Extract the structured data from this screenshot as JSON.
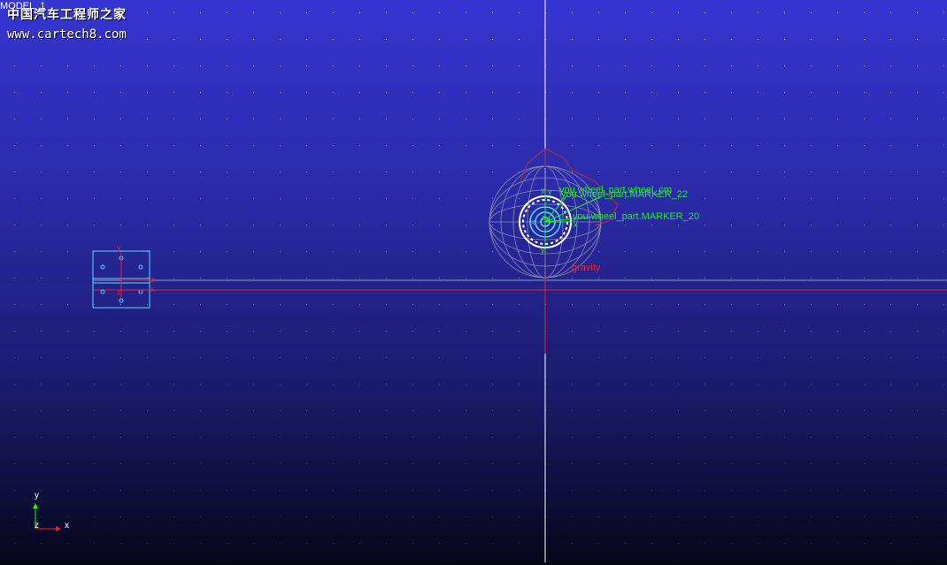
{
  "view": {
    "model_name": "MODEL_1",
    "watermark_cn": "中国汽车工程师之家",
    "watermark_url": "www.cartech8.com"
  },
  "colors": {
    "bg_top": "#3535d2",
    "bg_bottom": "#06061a",
    "grid_dot": "#c8c8ff",
    "marker_green": "#22ee22",
    "gravity_red": "#ee2222",
    "part_cyan": "#5ad7ff",
    "wheel_mesh": "#8a8aa8",
    "ground_axis_white": "#ffffff"
  },
  "markers": {
    "overlap_a": "you.wheel_part.wheel_cm",
    "overlap_b": "you.wheel_part.MARKER_22",
    "marker_20": "you.wheel_part.MARKER_20"
  },
  "gravity": {
    "label": "gravity"
  },
  "axis_letters": {
    "x": "x",
    "y": "y",
    "z": "z"
  },
  "triad": {
    "x": "x",
    "y": "y",
    "z": "z"
  },
  "icons": [
    "wheel-part",
    "chassis-part",
    "gravity-arrow",
    "view-triad"
  ]
}
